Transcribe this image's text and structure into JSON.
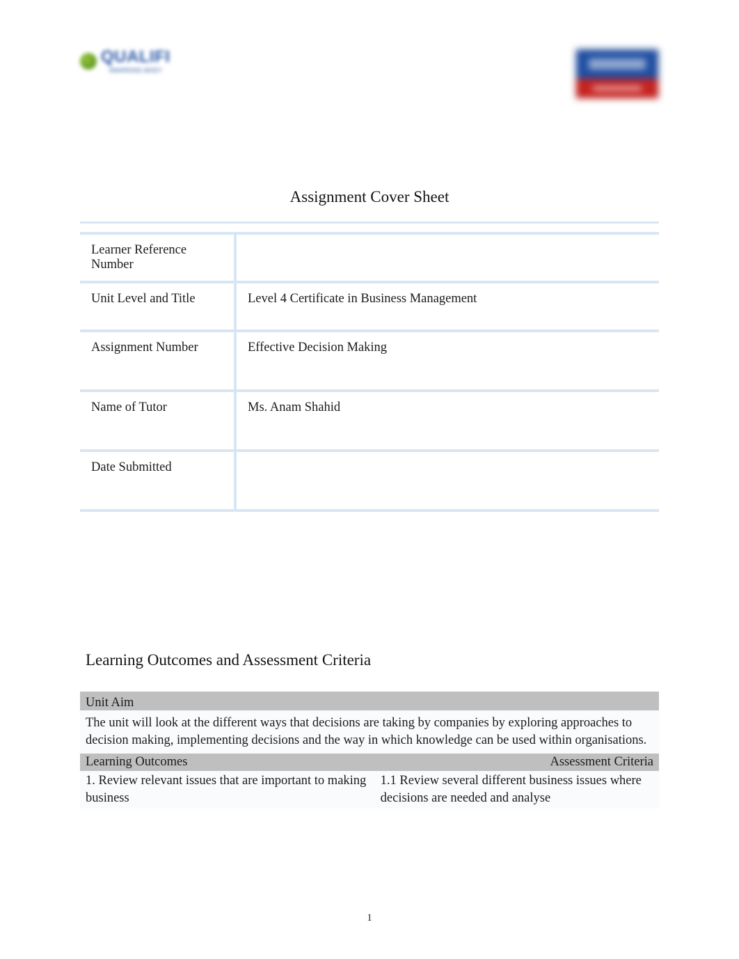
{
  "title": "Assignment Cover Sheet",
  "cover_rows": [
    {
      "label": "Learner Reference Number",
      "value": ""
    },
    {
      "label": "Unit Level and Title",
      "value": "Level 4 Certificate in Business Management"
    },
    {
      "label": "Assignment Number",
      "value": "Effective Decision Making"
    },
    {
      "label": "Name of Tutor",
      "value": "Ms. Anam Shahid"
    },
    {
      "label": "Date Submitted",
      "value": ""
    }
  ],
  "lo_heading": "Learning Outcomes and Assessment Criteria",
  "unit_aim": {
    "label": "Unit Aim",
    "text": "The unit will look at the different ways that decisions are taking by companies by exploring approaches to decision making, implementing decisions and the way in which knowledge can be used within organisations."
  },
  "criteria_header": {
    "left": "Learning Outcomes",
    "right": "Assessment Criteria"
  },
  "criteria_rows": [
    {
      "left": "1. Review relevant issues that are important to making business",
      "right": "1.1 Review several different business issues where decisions are needed and analyse"
    }
  ],
  "footer": {
    "page_number": "1"
  }
}
